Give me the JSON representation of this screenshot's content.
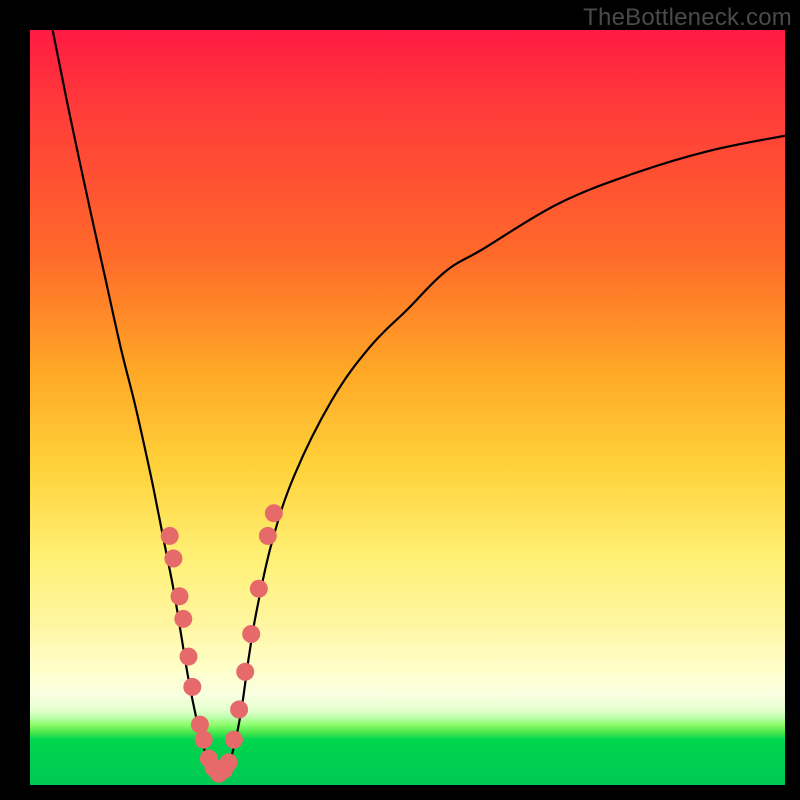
{
  "watermark": "TheBottleneck.com",
  "colors": {
    "frame": "#000000",
    "curve": "#000000",
    "dots": "#e76a6a",
    "gradient_top": "#ff1a44",
    "gradient_bottom": "#00c853"
  },
  "chart_data": {
    "type": "line",
    "title": "",
    "xlabel": "",
    "ylabel": "",
    "xlim": [
      0,
      100
    ],
    "ylim": [
      0,
      100
    ],
    "series": [
      {
        "name": "bottleneck-curve",
        "x": [
          3,
          5,
          8,
          10,
          12,
          14,
          16,
          17,
          18,
          19,
          20,
          21,
          22,
          23,
          24,
          25,
          26,
          27,
          28,
          29,
          30,
          32,
          35,
          40,
          45,
          50,
          55,
          60,
          70,
          80,
          90,
          100
        ],
        "y": [
          100,
          90,
          76,
          67,
          58,
          50,
          41,
          36,
          31,
          26,
          20,
          14,
          9,
          5,
          2,
          1,
          2,
          5,
          10,
          17,
          23,
          32,
          41,
          51,
          58,
          63,
          68,
          71,
          77,
          81,
          84,
          86
        ]
      }
    ],
    "highlighted_points": {
      "name": "scatter-dots",
      "points": [
        {
          "x": 18.5,
          "y": 33
        },
        {
          "x": 19.0,
          "y": 30
        },
        {
          "x": 19.8,
          "y": 25
        },
        {
          "x": 20.3,
          "y": 22
        },
        {
          "x": 21.0,
          "y": 17
        },
        {
          "x": 21.5,
          "y": 13
        },
        {
          "x": 22.5,
          "y": 8
        },
        {
          "x": 23.0,
          "y": 6
        },
        {
          "x": 23.7,
          "y": 3.5
        },
        {
          "x": 24.3,
          "y": 2.3
        },
        {
          "x": 25.0,
          "y": 1.5
        },
        {
          "x": 25.7,
          "y": 2.0
        },
        {
          "x": 26.3,
          "y": 3.0
        },
        {
          "x": 27.0,
          "y": 6
        },
        {
          "x": 27.7,
          "y": 10
        },
        {
          "x": 28.5,
          "y": 15
        },
        {
          "x": 29.3,
          "y": 20
        },
        {
          "x": 30.3,
          "y": 26
        },
        {
          "x": 31.5,
          "y": 33
        },
        {
          "x": 32.3,
          "y": 36
        }
      ]
    }
  }
}
